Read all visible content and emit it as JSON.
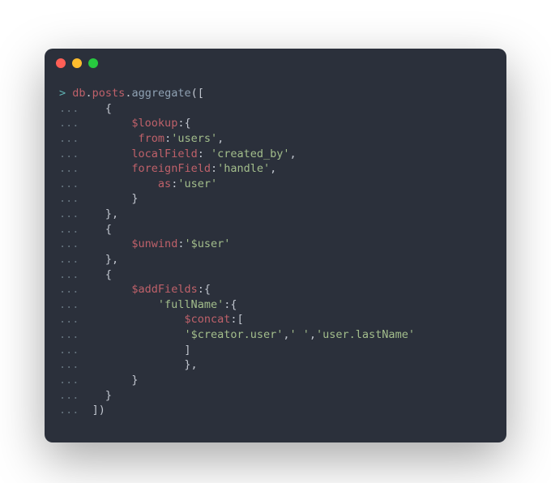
{
  "titlebar": {
    "buttons": [
      "close",
      "minimize",
      "zoom"
    ]
  },
  "code": {
    "lines": [
      [
        {
          "cls": "prompt",
          "t": "> "
        },
        {
          "cls": "var",
          "t": "db"
        },
        {
          "cls": "punct",
          "t": "."
        },
        {
          "cls": "var",
          "t": "posts"
        },
        {
          "cls": "punct",
          "t": "."
        },
        {
          "cls": "func",
          "t": "aggregate"
        },
        {
          "cls": "punct",
          "t": "(["
        }
      ],
      [
        {
          "cls": "dots",
          "t": "... "
        },
        {
          "cls": "punct",
          "t": "   {"
        }
      ],
      [
        {
          "cls": "dots",
          "t": "... "
        },
        {
          "cls": "punct",
          "t": "       "
        },
        {
          "cls": "key",
          "t": "$lookup"
        },
        {
          "cls": "colon",
          "t": ":"
        },
        {
          "cls": "punct",
          "t": "{"
        }
      ],
      [
        {
          "cls": "dots",
          "t": "... "
        },
        {
          "cls": "punct",
          "t": "        "
        },
        {
          "cls": "key",
          "t": "from"
        },
        {
          "cls": "colon",
          "t": ":"
        },
        {
          "cls": "string",
          "t": "'users'"
        },
        {
          "cls": "punct",
          "t": ","
        }
      ],
      [
        {
          "cls": "dots",
          "t": "... "
        },
        {
          "cls": "punct",
          "t": "       "
        },
        {
          "cls": "key",
          "t": "localField"
        },
        {
          "cls": "colon",
          "t": ": "
        },
        {
          "cls": "string",
          "t": "'created_by'"
        },
        {
          "cls": "punct",
          "t": ","
        }
      ],
      [
        {
          "cls": "dots",
          "t": "... "
        },
        {
          "cls": "punct",
          "t": "       "
        },
        {
          "cls": "key",
          "t": "foreignField"
        },
        {
          "cls": "colon",
          "t": ":"
        },
        {
          "cls": "string",
          "t": "'handle'"
        },
        {
          "cls": "punct",
          "t": ","
        }
      ],
      [
        {
          "cls": "dots",
          "t": "... "
        },
        {
          "cls": "punct",
          "t": "           "
        },
        {
          "cls": "key",
          "t": "as"
        },
        {
          "cls": "colon",
          "t": ":"
        },
        {
          "cls": "string",
          "t": "'user'"
        }
      ],
      [
        {
          "cls": "dots",
          "t": "... "
        },
        {
          "cls": "punct",
          "t": "       }"
        }
      ],
      [
        {
          "cls": "dots",
          "t": "... "
        },
        {
          "cls": "punct",
          "t": "   },"
        }
      ],
      [
        {
          "cls": "dots",
          "t": "... "
        },
        {
          "cls": "punct",
          "t": "   {"
        }
      ],
      [
        {
          "cls": "dots",
          "t": "... "
        },
        {
          "cls": "punct",
          "t": "       "
        },
        {
          "cls": "key",
          "t": "$unwind"
        },
        {
          "cls": "colon",
          "t": ":"
        },
        {
          "cls": "string",
          "t": "'$user'"
        }
      ],
      [
        {
          "cls": "dots",
          "t": "... "
        },
        {
          "cls": "punct",
          "t": "   },"
        }
      ],
      [
        {
          "cls": "dots",
          "t": "... "
        },
        {
          "cls": "punct",
          "t": "   {"
        }
      ],
      [
        {
          "cls": "dots",
          "t": "... "
        },
        {
          "cls": "punct",
          "t": "       "
        },
        {
          "cls": "key",
          "t": "$addFields"
        },
        {
          "cls": "colon",
          "t": ":"
        },
        {
          "cls": "punct",
          "t": "{"
        }
      ],
      [
        {
          "cls": "dots",
          "t": "... "
        },
        {
          "cls": "punct",
          "t": "           "
        },
        {
          "cls": "string",
          "t": "'fullName'"
        },
        {
          "cls": "colon",
          "t": ":"
        },
        {
          "cls": "punct",
          "t": "{"
        }
      ],
      [
        {
          "cls": "dots",
          "t": "... "
        },
        {
          "cls": "punct",
          "t": "               "
        },
        {
          "cls": "key",
          "t": "$concat"
        },
        {
          "cls": "colon",
          "t": ":"
        },
        {
          "cls": "punct",
          "t": "["
        }
      ],
      [
        {
          "cls": "dots",
          "t": "... "
        },
        {
          "cls": "punct",
          "t": "               "
        },
        {
          "cls": "string",
          "t": "'$creator.user'"
        },
        {
          "cls": "punct",
          "t": ","
        },
        {
          "cls": "string",
          "t": "' '"
        },
        {
          "cls": "punct",
          "t": ","
        },
        {
          "cls": "string",
          "t": "'user.lastName'"
        }
      ],
      [
        {
          "cls": "dots",
          "t": "... "
        },
        {
          "cls": "punct",
          "t": "               ]"
        }
      ],
      [
        {
          "cls": "dots",
          "t": "... "
        },
        {
          "cls": "punct",
          "t": "               },"
        }
      ],
      [
        {
          "cls": "dots",
          "t": "... "
        },
        {
          "cls": "punct",
          "t": "       }"
        }
      ],
      [
        {
          "cls": "dots",
          "t": "... "
        },
        {
          "cls": "punct",
          "t": "   }"
        }
      ],
      [
        {
          "cls": "dots",
          "t": "... "
        },
        {
          "cls": "punct",
          "t": " ])"
        }
      ]
    ]
  }
}
